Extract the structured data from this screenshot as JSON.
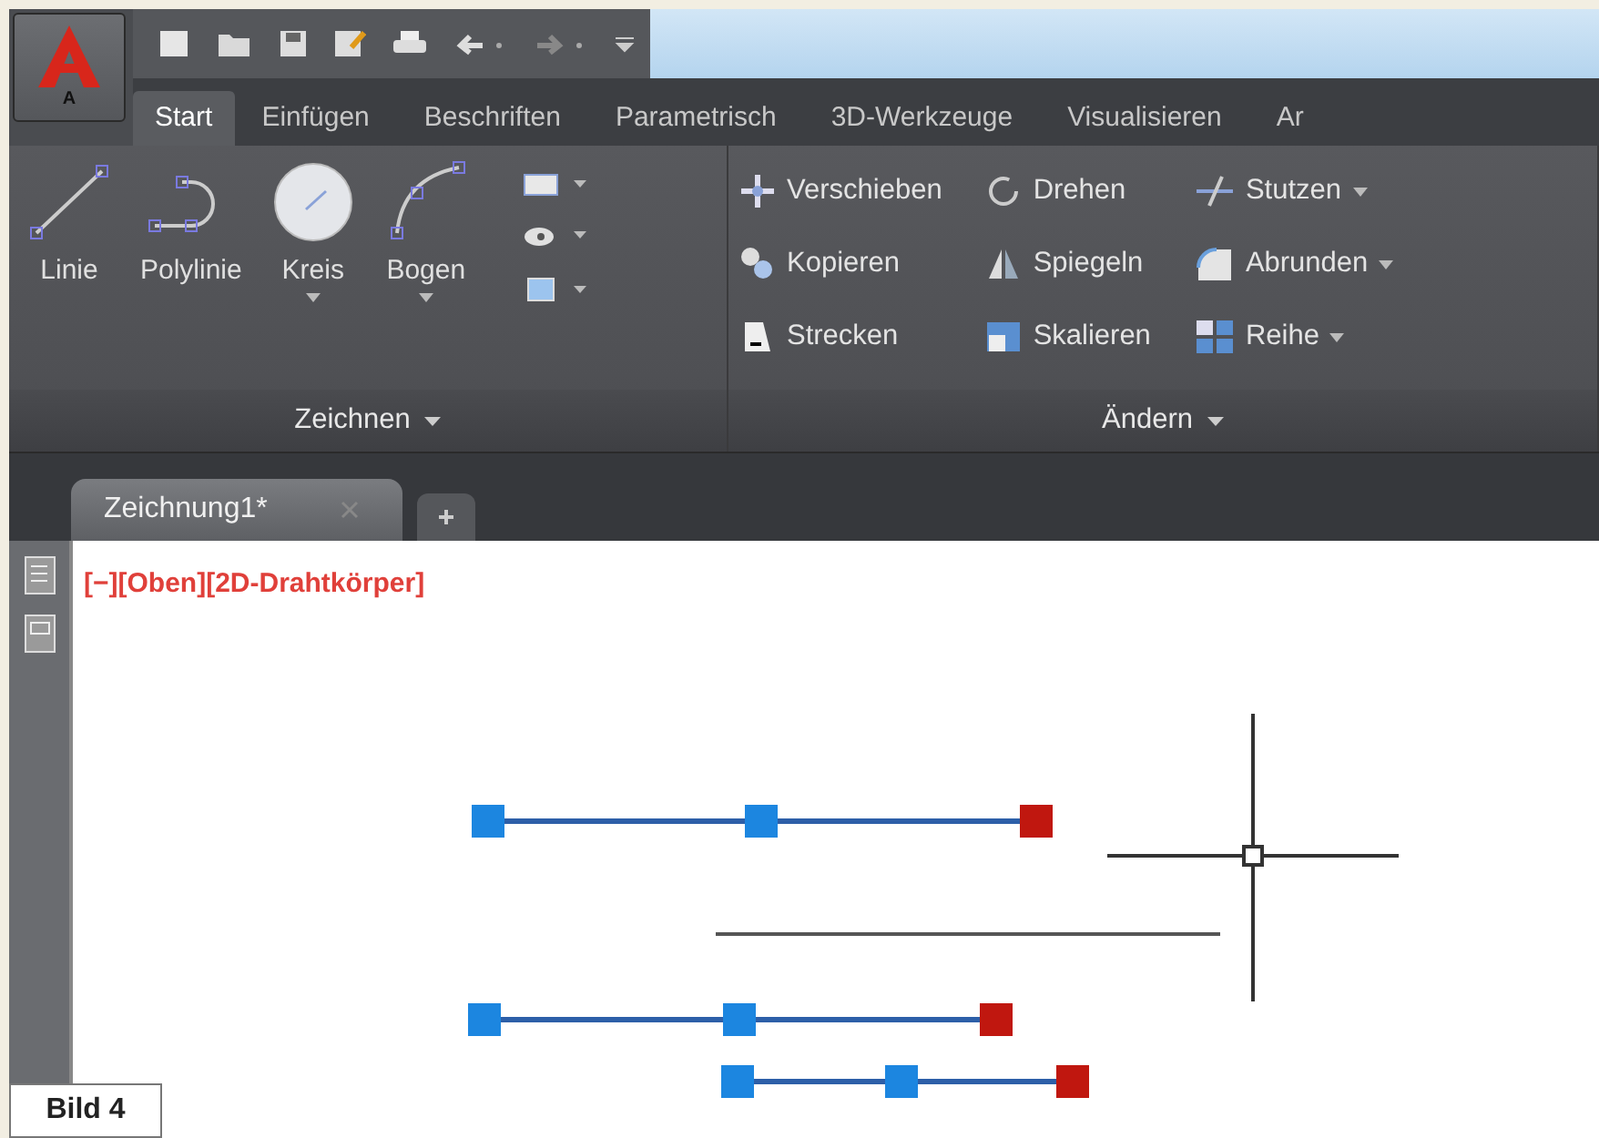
{
  "app_button": {
    "label": "A"
  },
  "ribbon_tabs": [
    {
      "label": "Start",
      "selected": true
    },
    {
      "label": "Einfügen",
      "selected": false
    },
    {
      "label": "Beschriften",
      "selected": false
    },
    {
      "label": "Parametrisch",
      "selected": false
    },
    {
      "label": "3D-Werkzeuge",
      "selected": false
    },
    {
      "label": "Visualisieren",
      "selected": false
    },
    {
      "label": "Ar",
      "selected": false
    }
  ],
  "panels": [
    {
      "title": "Zeichnen",
      "large_tools": [
        {
          "label": "Linie",
          "dropdown": false
        },
        {
          "label": "Polylinie",
          "dropdown": false
        },
        {
          "label": "Kreis",
          "dropdown": true
        },
        {
          "label": "Bogen",
          "dropdown": true
        }
      ]
    },
    {
      "title": "Ändern",
      "tools": [
        {
          "label": "Verschieben",
          "dropdown": false
        },
        {
          "label": "Kopieren",
          "dropdown": false
        },
        {
          "label": "Strecken",
          "dropdown": false
        },
        {
          "label": "Drehen",
          "dropdown": false
        },
        {
          "label": "Spiegeln",
          "dropdown": false
        },
        {
          "label": "Skalieren",
          "dropdown": false
        },
        {
          "label": "Stutzen",
          "dropdown": true
        },
        {
          "label": "Abrunden",
          "dropdown": true
        },
        {
          "label": "Reihe",
          "dropdown": true
        }
      ]
    }
  ],
  "document_tabs": [
    {
      "label": "Zeichnung1*",
      "selected": true
    }
  ],
  "viewport_label": "[−][Oben][2D-Drahtkörper]",
  "drawing": {
    "lines": [
      {
        "grips": [
          {
            "color": "#1c86e0"
          },
          {
            "color": "#1c86e0"
          },
          {
            "color": "#c0170f"
          }
        ]
      },
      {
        "kind": "plain"
      },
      {
        "grips": [
          {
            "color": "#1c86e0"
          },
          {
            "color": "#1c86e0"
          },
          {
            "color": "#c0170f"
          }
        ]
      },
      {
        "grips": [
          {
            "color": "#1c86e0"
          },
          {
            "color": "#1c86e0"
          },
          {
            "color": "#c0170f"
          }
        ]
      }
    ]
  },
  "caption": "Bild 4"
}
